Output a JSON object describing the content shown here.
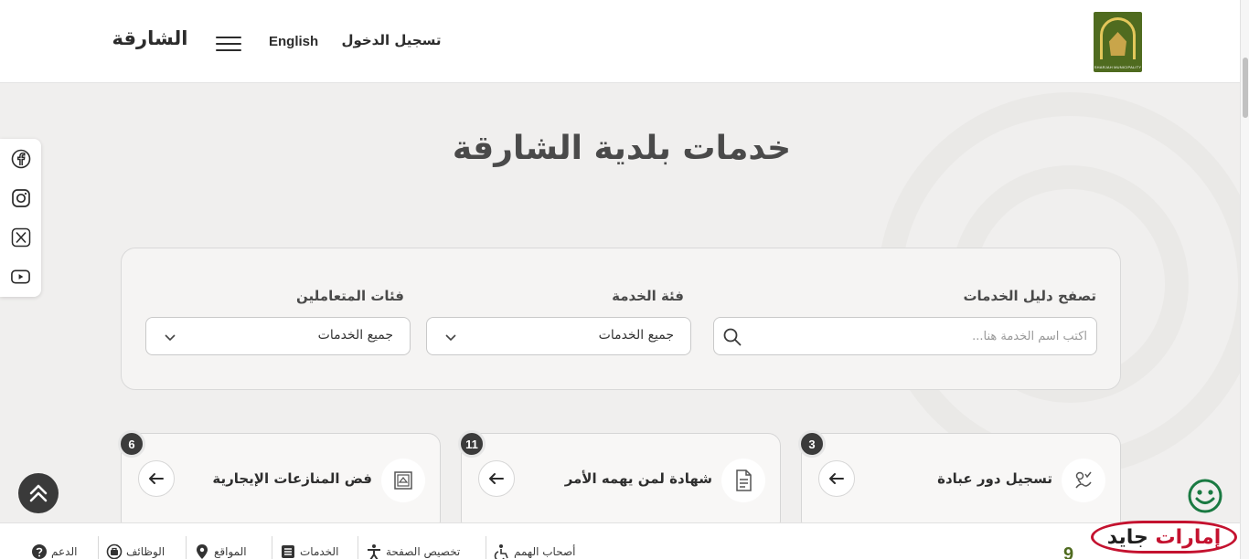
{
  "header": {
    "login_label": "تسجيل الدخول",
    "language_label": "English",
    "brand_title": "الشارقة",
    "logo_text": "SHARJAH MUNICIPALITY"
  },
  "page": {
    "title": "خدمات بلدية الشارقة"
  },
  "social": {
    "icons": [
      "facebook-icon",
      "instagram-icon",
      "x-icon",
      "youtube-icon"
    ]
  },
  "filters": {
    "search_label": "تصفح دليل الخدمات",
    "search_placeholder": "اكتب اسم الخدمة هنا...",
    "search_value": "",
    "category_label": "فئة الخدمة",
    "category_value": "جميع الخدمات",
    "audience_label": "فئات المتعاملين",
    "audience_value": "جميع الخدمات"
  },
  "services": [
    {
      "name": "تسجيل دور عبادة",
      "count": "3",
      "icon": "worship-registration-icon"
    },
    {
      "name": "شهادة لمن يهمه الأمر",
      "count": "11",
      "icon": "certificate-document-icon"
    },
    {
      "name": "فض المنازعات الإيجارية",
      "count": "6",
      "icon": "rental-dispute-icon"
    }
  ],
  "bottom_bar": {
    "items": [
      {
        "label": "أصحاب الهمم",
        "icon": "accessibility-icon"
      },
      {
        "label": "تخصيص الصفحة",
        "icon": "customize-person-icon"
      },
      {
        "label": "الخدمات",
        "icon": "services-list-icon"
      },
      {
        "label": "المواقع",
        "icon": "location-pin-icon"
      },
      {
        "label": "الوظائف",
        "icon": "jobs-icon"
      },
      {
        "label": "الدعم",
        "icon": "help-icon"
      }
    ]
  },
  "watermark": {
    "part1": "إمارات",
    "part2": "جايد"
  },
  "colors": {
    "brand_green": "#4f6b1f",
    "badge_dark": "#3b3b3b",
    "watermark_red": "#c4122f"
  }
}
